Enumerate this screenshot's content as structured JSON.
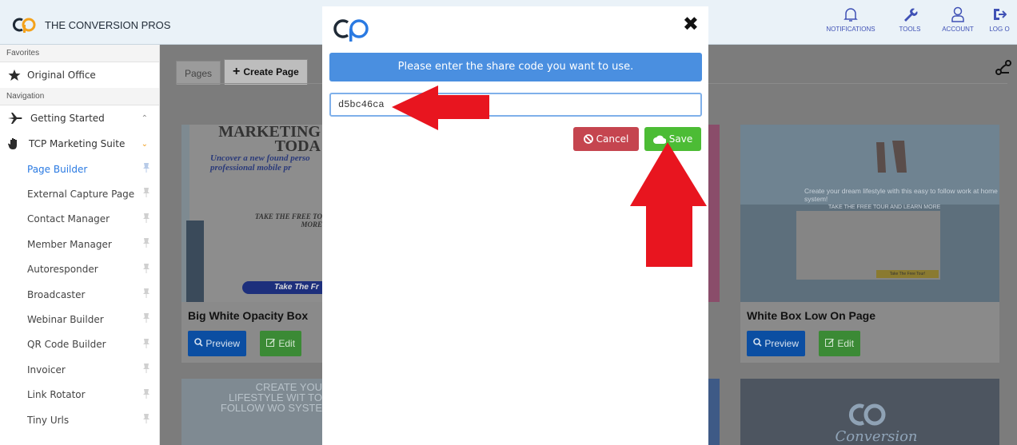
{
  "header": {
    "brand": "THE CONVERSION PROS",
    "brand_bold": "CONVERSION",
    "nav": [
      {
        "label": "NOTIFICATIONS",
        "icon": "bell-icon"
      },
      {
        "label": "TOOLS",
        "icon": "wrench-icon"
      },
      {
        "label": "ACCOUNT",
        "icon": "user-icon"
      },
      {
        "label": "LOG O",
        "icon": "logout-icon"
      }
    ]
  },
  "sidebar": {
    "favorites_label": "Favorites",
    "favorite_item": "Original Office",
    "navigation_label": "Navigation",
    "groups": [
      {
        "label": "Getting Started",
        "chevron": "^"
      },
      {
        "label": "TCP Marketing Suite",
        "chevron": "v"
      }
    ],
    "items": [
      {
        "label": "Page Builder",
        "active": true
      },
      {
        "label": "External Capture Page"
      },
      {
        "label": "Contact Manager"
      },
      {
        "label": "Member Manager"
      },
      {
        "label": "Autoresponder"
      },
      {
        "label": "Broadcaster"
      },
      {
        "label": "Webinar Builder"
      },
      {
        "label": "QR Code Builder"
      },
      {
        "label": "Invoicer"
      },
      {
        "label": "Link Rotator"
      },
      {
        "label": "Tiny Urls"
      }
    ]
  },
  "main": {
    "tabs": [
      {
        "label": "Pages"
      },
      {
        "label": "Create Page",
        "prefix": "+"
      }
    ],
    "cards": [
      {
        "title": "Big White Opacity Box",
        "headline": "MARKETING TODA",
        "subhead": "Uncover a new found perso professional mobile pr",
        "cta": "TAKE THE FREE TO MORE",
        "button": "Take The Fr"
      },
      {
        "title": "White Box Low On Page",
        "headline": "Create your dream lifestyle with this easy to follow work at home system!",
        "tagline": "TAKE THE FREE TOUR AND LEARN MORE",
        "cta_button": "Take The Free Tour!"
      }
    ],
    "bottom_cards": [
      {
        "headline": "CREATE YOU LIFESTYLE WIT TO FOLLOW WO SYSTE"
      },
      {
        "headline": "Conversion Pros"
      }
    ],
    "preview_label": "Preview",
    "edit_label": "Edit"
  },
  "modal": {
    "prompt": "Please enter the share code you want to use.",
    "code_value": "d5bc46ca",
    "cancel_label": "Cancel",
    "save_label": "Save",
    "close_glyph": "✖"
  },
  "colors": {
    "prompt_bg": "#4a8fe0",
    "cancel_bg": "#c5454f",
    "save_bg": "#4cbc35",
    "arrow": "#e8151f",
    "brand_orange": "#f4a21b"
  }
}
